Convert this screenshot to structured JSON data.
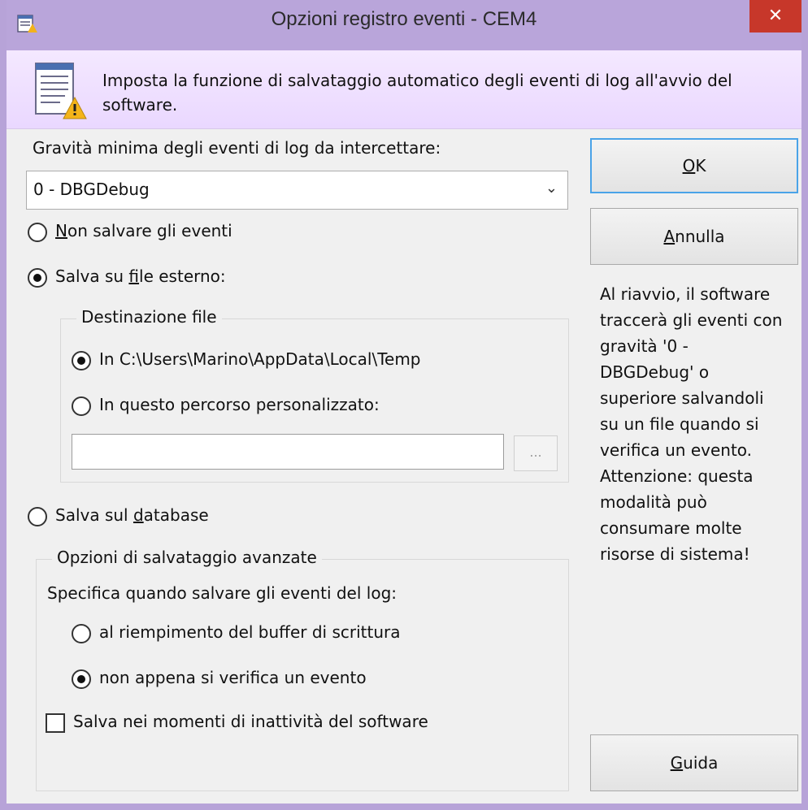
{
  "window": {
    "title": "Opzioni registro eventi - CEM4",
    "close_label": "✕"
  },
  "banner": {
    "text": "Imposta la funzione di salvataggio automatico degli eventi di log all'avvio del software."
  },
  "severity": {
    "label": "Gravità minima degli eventi di log da intercettare:",
    "selected": "0 - DBGDebug",
    "chevron": "⌄"
  },
  "mode": {
    "none_prefix": "",
    "none_hot": "N",
    "none_rest": "on salvare gli eventi",
    "file_prefix": "Salva su ",
    "file_hot": "f",
    "file_rest": "ile esterno:",
    "db_prefix": "Salva sul ",
    "db_hot": "d",
    "db_rest": "atabase",
    "selected": "file"
  },
  "destination": {
    "group_title": "Destinazione file",
    "option_temp": "In C:\\Users\\Marino\\AppData\\Local\\Temp",
    "option_custom": "In questo percorso personalizzato:",
    "custom_path": "",
    "browse_label": "...",
    "selected": "temp"
  },
  "advanced": {
    "group_title": "Opzioni di salvataggio avanzate",
    "instruction": "Specifica quando salvare gli eventi del log:",
    "option_buffer": "al riempimento del buffer di scrittura",
    "option_immediate": "non appena si verifica un evento",
    "selected": "immediate",
    "idle_label": "Salva nei momenti di inattività del software",
    "idle_checked": false
  },
  "buttons": {
    "ok_hot": "O",
    "ok_rest": "K",
    "cancel_hot": "A",
    "cancel_rest": "nnulla",
    "help_hot": "G",
    "help_rest": "uida"
  },
  "info": {
    "text": "Al riavvio, il software traccerà gli eventi con gravità '0 - DBGDebug' o superiore salvandoli su un file quando si verifica un evento. Attenzione: questa modalità può consumare molte risorse di sistema!"
  },
  "colors": {
    "titlebar": "#b9a5da",
    "close": "#c7372a",
    "accent_border": "#4aa3e8"
  }
}
